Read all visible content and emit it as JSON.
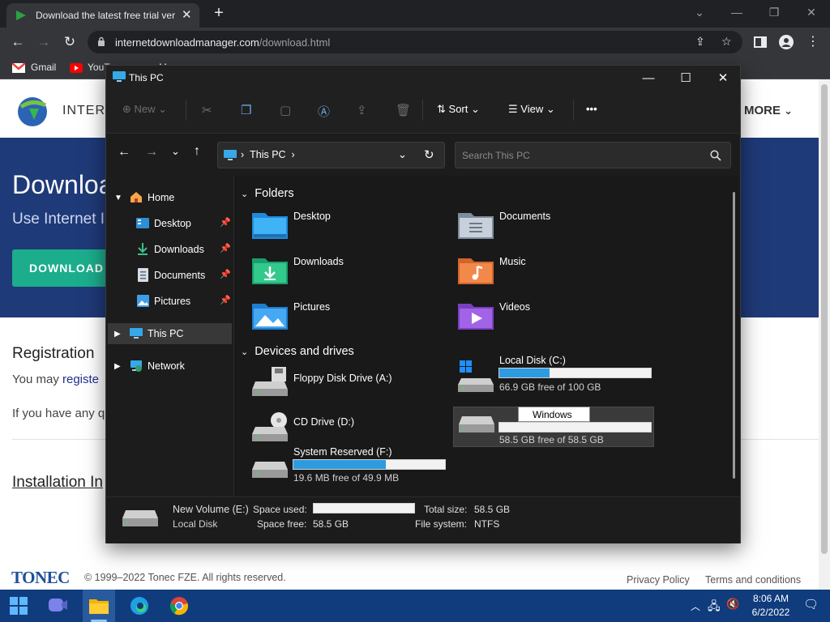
{
  "browser": {
    "tab_title": "Download the latest free trial ver",
    "url_host": "internetdownloadmanager.com",
    "url_path": "/download.html",
    "bookmarks": [
      "Gmail",
      "YouT",
      "M"
    ]
  },
  "site": {
    "brand_partial": "INTERN",
    "more_label": "MORE",
    "banner_title": "Downloa",
    "banner_sub": "Use Internet I",
    "download_button": "DOWNLOAD",
    "registration": "Registration",
    "you_may": "You may",
    "register_link": "registe",
    "if_you_have": "If you have any q",
    "installation": "Installation In",
    "tonec": "TONEC",
    "copyright": "© 1999–2022 Tonec FZE. All rights reserved.",
    "privacy": "Privacy Policy",
    "terms": "Terms and conditions"
  },
  "explorer": {
    "title": "This PC",
    "toolbar": {
      "new": "New",
      "sort": "Sort",
      "view": "View",
      "more": "•••"
    },
    "address": {
      "location": "This PC"
    },
    "search_placeholder": "Search This PC",
    "nav": {
      "home": "Home",
      "desktop": "Desktop",
      "downloads": "Downloads",
      "documents": "Documents",
      "pictures": "Pictures",
      "this_pc": "This PC",
      "network": "Network"
    },
    "folders_header": "Folders",
    "folders": {
      "desktop": "Desktop",
      "documents": "Documents",
      "downloads": "Downloads",
      "music": "Music",
      "pictures": "Pictures",
      "videos": "Videos"
    },
    "devices_header": "Devices and drives",
    "drives": {
      "floppy": {
        "name": "Floppy Disk Drive (A:)"
      },
      "c": {
        "name": "Local Disk (C:)",
        "free": "66.9 GB free of 100 GB",
        "used_fraction": 0.331
      },
      "cd": {
        "name": "CD Drive (D:)"
      },
      "e": {
        "rename_value": "Windows",
        "free": "58.5 GB free of 58.5 GB",
        "used_fraction": 0.0
      },
      "f": {
        "name": "System Reserved (F:)",
        "free": "19.6 MB free of 49.9 MB",
        "used_fraction": 0.607
      }
    },
    "details": {
      "name": "New Volume (E:)",
      "type": "Local Disk",
      "space_used_label": "Space used:",
      "space_free_label": "Space free:",
      "space_free_value": "58.5 GB",
      "total_size_label": "Total size:",
      "total_size_value": "58.5 GB",
      "file_system_label": "File system:",
      "file_system_value": "NTFS",
      "used_fraction": 0.0
    }
  },
  "taskbar": {
    "time": "8:06 AM",
    "date": "6/2/2022"
  },
  "colors": {
    "accent": "#2d9be0",
    "site_banner": "#1f3a78",
    "download_button": "#1cad8c",
    "taskbar": "#103c7d"
  }
}
